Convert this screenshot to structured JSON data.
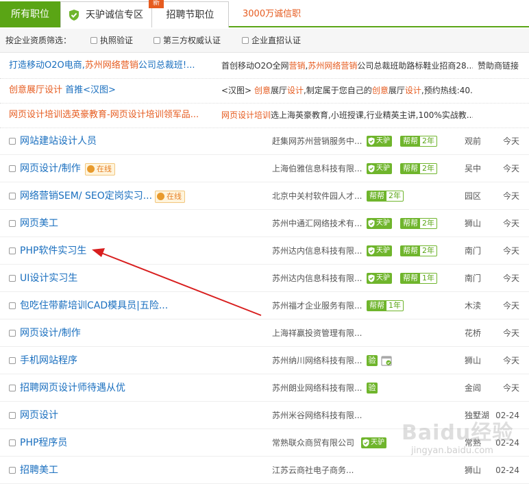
{
  "tabs": {
    "all": "所有职位",
    "zone": "天驴诚信专区",
    "new_badge": "新",
    "fair": "招聘节职位",
    "link": "3000万诚信职位"
  },
  "filter": {
    "label": "按企业资质筛选：",
    "options": [
      "执照验证",
      "第三方权威认证",
      "企业直招认证"
    ]
  },
  "ads": [
    {
      "title": [
        "打造移动O2O电商,",
        "苏州网络营销",
        "公司总裁班!..."
      ],
      "desc": [
        "首创移动O2O全网",
        "营销",
        ",",
        "苏州网络营销",
        "公司总裁班助路标鞋业招商28..."
      ],
      "link": "赞助商链接"
    },
    {
      "title": [
        "创意展厅设计",
        " 首推<汉图>"
      ],
      "desc": [
        "<汉图> ",
        "创意",
        "展厅",
        "设计",
        ",制定属于您自己的",
        "创意",
        "展厅",
        "设计",
        ",预约热线:40..."
      ]
    },
    {
      "title": [
        "网页设计培训选英豪教育-网页设计培训领军品..."
      ],
      "desc": [
        "网页设计培训",
        "选上海英豪教育,小班授课,行业精英主讲,100%实战教..."
      ]
    }
  ],
  "badges": {
    "tianlv": "天驴",
    "bangbang": "帮帮",
    "yan": "验",
    "online": "在线"
  },
  "jobs": [
    {
      "title": "网站建站设计人员",
      "company": "赶集网苏州营销服务中...",
      "years": "2年",
      "location": "观前",
      "date": "今天"
    },
    {
      "title": "网页设计/制作",
      "online": true,
      "company": "上海伯雅信息科技有限...",
      "years": "2年",
      "location": "吴中",
      "date": "今天"
    },
    {
      "title": "网络营销SEM/ SEO定岗实习...",
      "online": true,
      "company": "北京中关村软件园人才...",
      "years": "2年",
      "location": "园区",
      "date": "今天"
    },
    {
      "title": "网页美工",
      "company": "苏州中通汇网络技术有...",
      "years": "2年",
      "location": "狮山",
      "date": "今天"
    },
    {
      "title": "PHP软件实习生",
      "company": "苏州达内信息科技有限...",
      "years": "2年",
      "location": "南门",
      "date": "今天"
    },
    {
      "title": "UI设计实习生",
      "company": "苏州达内信息科技有限...",
      "years": "1年",
      "location": "南门",
      "date": "今天"
    },
    {
      "title": "包吃住带薪培训CAD模具员|五险...",
      "company": "苏州福才企业服务有限...",
      "years": "1年",
      "location": "木渎",
      "date": "今天"
    },
    {
      "title": "网页设计/制作",
      "company": "上海祥赢投资管理有限...",
      "location": "花桥",
      "date": "今天"
    },
    {
      "title": "手机网站程序",
      "company": "苏州纳川网络科技有限...",
      "location": "狮山",
      "date": "今天"
    },
    {
      "title": "招聘网页设计师待遇从优",
      "company": "苏州朗业网络科技有限...",
      "location": "金阊",
      "date": "今天"
    },
    {
      "title": "网页设计",
      "company": "苏州米谷网络科技有限...",
      "location": "独墅湖",
      "date": "02-24"
    },
    {
      "title": "PHP程序员",
      "company": "常熟联众商贸有限公司",
      "location": "常熟",
      "date": "02-24"
    },
    {
      "title": "招聘美工",
      "company": "江苏云商社电子商务...",
      "location": "狮山",
      "date": "02-24"
    }
  ],
  "watermark": {
    "logo": "Baidu经验",
    "url": "jingyan.baidu.com"
  },
  "colors": {
    "brand_green": "#5aa515",
    "badge_green": "#6fb52c",
    "link_blue": "#1a6fbf",
    "highlight_orange": "#e65b1f",
    "arrow_red": "#d81e1e"
  }
}
